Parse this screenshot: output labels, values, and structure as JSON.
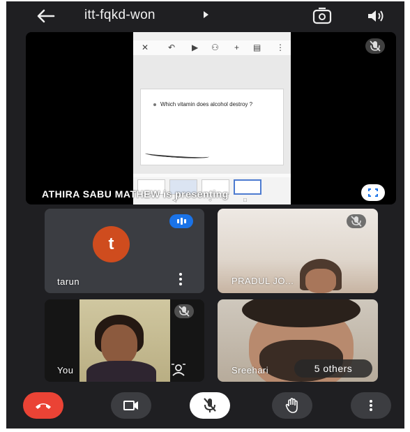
{
  "header": {
    "meeting_code": "itt-fqkd-won",
    "back_icon": "arrow-left-icon",
    "switch_camera_icon": "camera-switch-icon",
    "audio_icon": "speaker-icon"
  },
  "presentation": {
    "presenter_caption": "ATHIRA SABU MATHEW is presenting",
    "shared_slide_text": "Which vitamin does alcohol destroy ?",
    "mute_icon": "mic-off-icon",
    "fullscreen_icon": "fullscreen-icon"
  },
  "participants": [
    {
      "name": "tarun",
      "avatar_letter": "t",
      "avatar_color": "#cf4c1e",
      "status_icon": "speaking-indicator-icon"
    },
    {
      "name": "PRADUL JO...",
      "status_icon": "mic-off-icon"
    },
    {
      "name": "You",
      "status_icon": "mic-off-icon"
    },
    {
      "name": "Sreehari",
      "overflow_label": "5 others"
    }
  ],
  "controls": {
    "end_call_icon": "end-call-icon",
    "camera_icon": "video-icon",
    "mic_icon": "mic-off-icon",
    "raise_hand_icon": "hand-icon",
    "more_icon": "more-vert-icon"
  },
  "colors": {
    "end_call": "#ea4335",
    "speaking_badge": "#1a73e8",
    "background": "#1f1f22"
  }
}
